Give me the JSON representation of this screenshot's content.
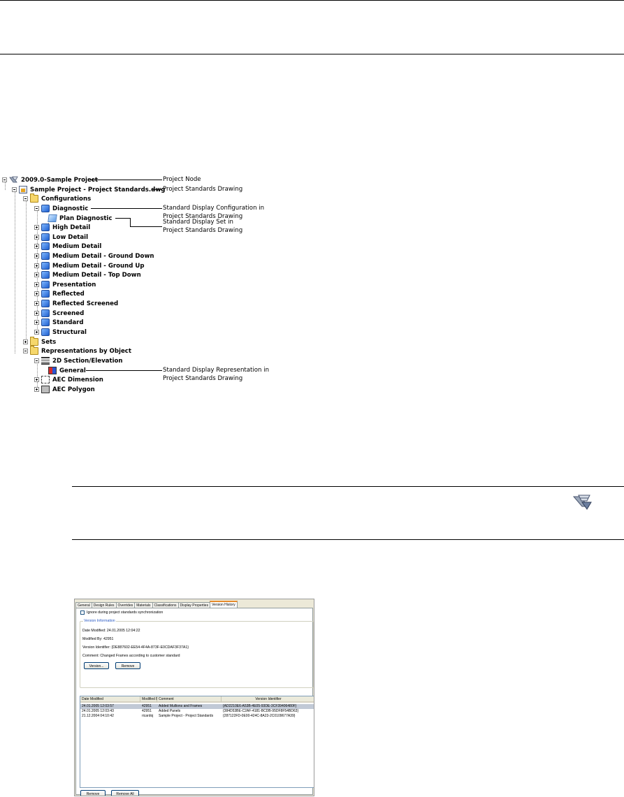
{
  "tree": {
    "nodes": [
      {
        "label": "2009.0-Sample Project",
        "icon": "project-icon"
      },
      {
        "label": "Sample Project - Project Standards.dwg",
        "icon": "drawing-icon"
      },
      {
        "label": "Configurations",
        "icon": "folder-icon"
      },
      {
        "label": "Diagnostic",
        "icon": "display-configuration-icon"
      },
      {
        "label": "Plan Diagnostic",
        "icon": "display-set-icon"
      },
      {
        "label": "High Detail",
        "icon": "display-configuration-icon"
      },
      {
        "label": "Low Detail",
        "icon": "display-configuration-icon"
      },
      {
        "label": "Medium Detail",
        "icon": "display-configuration-icon"
      },
      {
        "label": "Medium Detail - Ground Down",
        "icon": "display-configuration-icon"
      },
      {
        "label": "Medium Detail - Ground Up",
        "icon": "display-configuration-icon"
      },
      {
        "label": "Medium Detail - Top Down",
        "icon": "display-configuration-icon"
      },
      {
        "label": "Presentation",
        "icon": "display-configuration-icon"
      },
      {
        "label": "Reflected",
        "icon": "display-configuration-icon"
      },
      {
        "label": "Reflected Screened",
        "icon": "display-configuration-icon"
      },
      {
        "label": "Screened",
        "icon": "display-configuration-icon"
      },
      {
        "label": "Standard",
        "icon": "display-configuration-icon"
      },
      {
        "label": "Structural",
        "icon": "display-configuration-icon"
      },
      {
        "label": "Sets",
        "icon": "folder-icon"
      },
      {
        "label": "Representations by Object",
        "icon": "folder-icon"
      },
      {
        "label": "2D Section/Elevation",
        "icon": "section-elevation-icon"
      },
      {
        "label": "General",
        "icon": "display-representation-icon"
      },
      {
        "label": "AEC Dimension",
        "icon": "dimension-icon"
      },
      {
        "label": "AEC Polygon",
        "icon": "polygon-icon"
      }
    ],
    "callouts": [
      {
        "text": "Project Node"
      },
      {
        "text": "Project Standards Drawing"
      },
      {
        "text": "Standard Display Configuration in\nProject Standards Drawing"
      },
      {
        "text": "Standard Display Set in\nProject Standards Drawing"
      },
      {
        "text": "Standard Display Representation in\nProject Standards Drawing"
      }
    ]
  },
  "note": {
    "icon": "project-standards-icon"
  },
  "dialog": {
    "tabs": [
      "General",
      "Design Rules",
      "Overrides",
      "Materials",
      "Classifications",
      "Display Properties",
      "Version History"
    ],
    "active_tab": "Version History",
    "ignore_sync_label": "Ignore during project standards synchronization",
    "group_title": "Version Information",
    "date_modified": "Date Modified: 24.01.2005 12:04:22",
    "modified_by": "Modified By: 42951",
    "version_identifier": "Version Identifier: {DE887602-EE54-4F4A-873F-E0CDAF3F37A1}",
    "comment": "Comment: Changed Frames according to customer standard",
    "version_button": "Version...",
    "remove_button": "Remove",
    "columns": [
      "Date Modified",
      "Modified By",
      "Comment",
      "Version Identifier"
    ],
    "rows": [
      [
        "24.01.2005 12:03:57",
        "42951",
        "Added Mullions and Frames",
        "{AD2210E6-A53B-4E05-93DE-3CF39406480F}"
      ],
      [
        "24.01.2005 12:03:43",
        "42951",
        "Added Panels",
        "{384D53BE-C2AF-4181-BCDB-95DF8F54BD63}"
      ],
      [
        "21.12.2004 04:10:42",
        "ricardoj",
        "Sample Project - Project Standards",
        "{287122FD-0E00-424C-8A23-2C0109677A39}"
      ]
    ],
    "footer_remove": "Remove",
    "footer_remove_all": "Remove All"
  }
}
